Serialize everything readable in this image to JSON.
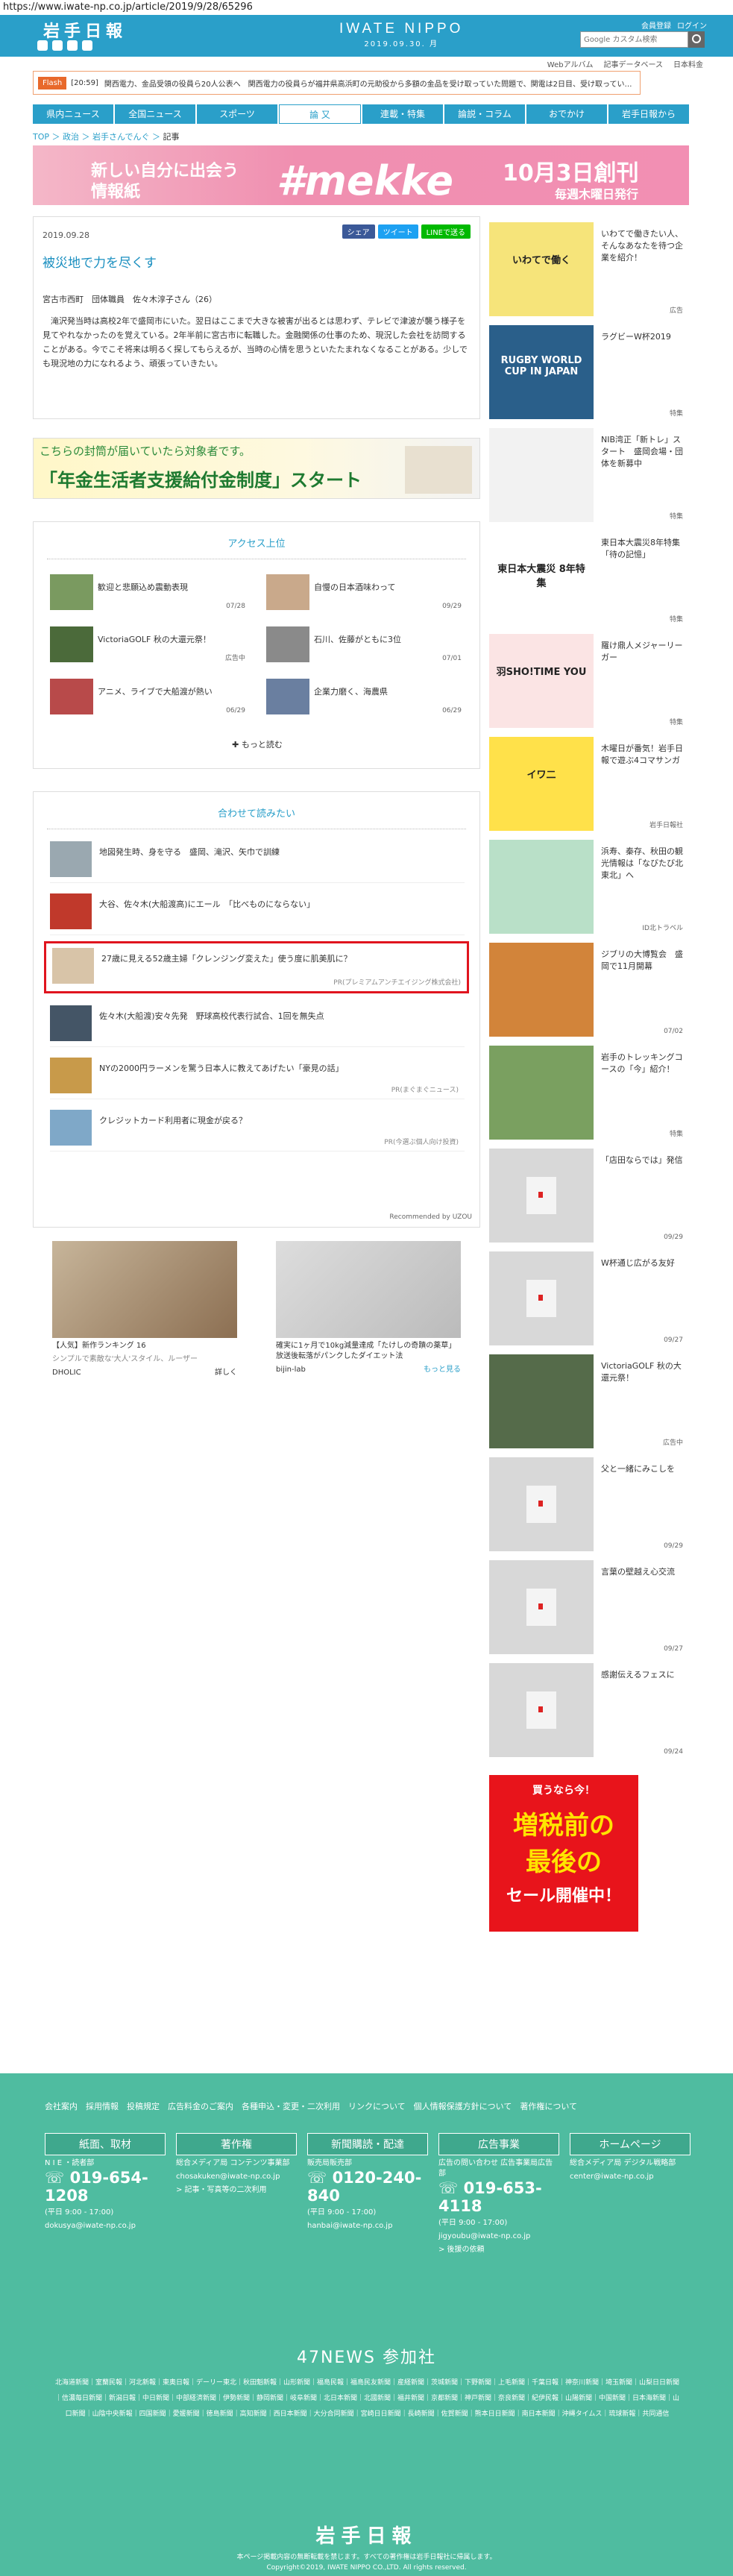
{
  "url": "https://www.iwate-np.co.jp/article/2019/9/28/65296",
  "header": {
    "logo": "岩手日報",
    "brand": "IWATE NIPPO",
    "date": "2019.09.30. 月",
    "register": "会員登録",
    "login": "ログイン",
    "search_placeholder": "Google カスタム検索",
    "sublinks": [
      "Webアルバム",
      "記事データベース",
      "日本料金"
    ]
  },
  "flash": {
    "tag": "Flash",
    "time": "[20:59]",
    "text": "関西電力、金品受領の役員ら20人公表へ　関西電力の役員らが福井県高浜町の元助役から多額の金品を受け取っていた問題で、関電は2日目、受け取ってい…"
  },
  "nav": [
    "県内ニュース",
    "全国ニュース",
    "スポーツ",
    "論 又",
    "連載・特集",
    "論説・コラム",
    "おでかけ",
    "岩手日報から"
  ],
  "breadcrumb": {
    "top": "TOP",
    "cat": "政治",
    "sub": "岩手さんでんぐ",
    "cur": "記事"
  },
  "banner": {
    "l1": "新しい自分に出会う",
    "l2": "情報紙",
    "big": "#mekke",
    "r1": "10月3日創刊",
    "r2": "毎週木曜日発行"
  },
  "article": {
    "date": "2019.09.28",
    "share": [
      "シェア",
      "ツイート",
      "LINEで送る"
    ],
    "title": "被災地で力を尽くす",
    "byline": "宮古市西町　団体職員　佐々木淳子さん（26）",
    "body": "滝沢発当時は高校2年で盛岡市にいた。翌日はここまで大きな被害が出るとは思わず、テレビで津波が襲う様子を見てやれなかったのを覚えている。2年半前に宮古市に転職した。金融関係の仕事のため、現況した会社を訪問することがある。今でこそ将来は明るく探してもらえるが、当時の心情を思うといたたまれなくなることがある。少しでも現況地の力になれるよう、頑張っていきたい。"
  },
  "ad_pension": {
    "small": "こちらの封筒が届いていたら対象者です。",
    "big": "「年金生活者支援給付金制度」スタート"
  },
  "ranking": {
    "title": "アクセス上位",
    "more": "もっと読む",
    "items": [
      {
        "title": "歓迎と悲願込め震動表現",
        "date": "07/28"
      },
      {
        "title": "自慢の日本酒味わって",
        "date": "09/29"
      },
      {
        "title": "VictoriaGOLF 秋の大還元祭！",
        "date": "広告中"
      },
      {
        "title": "石川、佐藤がともに3位",
        "date": "07/01"
      },
      {
        "title": "アニメ、ライブで大船渡が熱い",
        "date": "06/29"
      },
      {
        "title": "企業力磨く、海農県",
        "date": "06/29"
      }
    ]
  },
  "recommend": {
    "title": "合わせて読みたい",
    "footer": "Recommended by UZOU",
    "items": [
      {
        "title": "地図発生時、身を守る　盛岡、滝沢、矢巾で訓練",
        "pr": ""
      },
      {
        "title": "大谷、佐々木(大船渡高)にエール　「比べものにならない」",
        "pr": ""
      },
      {
        "title": "27歳に見える52歳主婦「クレンジング変えた」使う度に肌美肌に？",
        "pr": "PR(プレミアムアンチエイジング株式会社)"
      },
      {
        "title": "佐々木(大船渡)安々先発　野球高校代表行試合、1回を無失点",
        "pr": ""
      },
      {
        "title": "NYの2000円ラーメンを驚う日本人に教えてあげたい「豪見の話」",
        "pr": "PR(まぐまぐニュース)"
      },
      {
        "title": "クレジットカード利用者に現金が戻る？",
        "pr": "PR(今選ぶ個人向け投資)"
      }
    ]
  },
  "ads": {
    "a": {
      "title": "【人気】新作ランキング 16",
      "sub": "シンプルで素敵な'大人'スタイル、ルーザー",
      "brand": "DHOLIC",
      "label": "詳しく"
    },
    "b": {
      "title": "確実に1ヶ月で10kg減量達成「たけしの奇蹟の薬草」放送後転落がパンクしたダイエット法",
      "brand": "bijin-lab",
      "label": "もっと見る",
      "tag": "広告"
    }
  },
  "side": [
    {
      "title": "いわてで働きたい人、そんなあなたを待つ企業を紹介！",
      "tag": "広告",
      "img": "いわてで働く"
    },
    {
      "title": "ラグビーW杯2019",
      "tag": "特集",
      "img": "RUGBY WORLD CUP IN JAPAN"
    },
    {
      "title": "NIB湾正「新トレ」スタート　盛岡会場・団体を新募中",
      "tag": "特集",
      "img": ""
    },
    {
      "title": "東日本大震災8年特集「待の記憶」",
      "tag": "特集",
      "img": "東日本大震災 8年特集"
    },
    {
      "title": "羅け鼎人メジャーリーガー",
      "tag": "特集",
      "img": "羽SHO!TIME YOU"
    },
    {
      "title": "木曜日が番気！岩手日報で遊ぶ4コマサンガ",
      "tag": "岩手日報社",
      "img": "イワ二"
    },
    {
      "title": "浜寿、秦存、秋田の観光情報は「なびたび北東北」へ",
      "tag": "ID北トラベル",
      "img": ""
    },
    {
      "title": "ジブリの大博覧会　盛岡で11月開幕",
      "tag": "07/02",
      "img": ""
    },
    {
      "title": "岩手のトレッキングコースの「今」紹介！",
      "tag": "特集",
      "img": ""
    },
    {
      "title": "「店田ならでは」発信",
      "tag": "09/29",
      "img": ""
    },
    {
      "title": "W杯通じ広がる友好",
      "tag": "09/27",
      "img": ""
    },
    {
      "title": "VictoriaGOLF 秋の大還元祭！",
      "tag": "広告中",
      "img": ""
    },
    {
      "title": "父と一緒にみこしを",
      "tag": "09/29",
      "img": ""
    },
    {
      "title": "言葉の壁越え心交流",
      "tag": "09/27",
      "img": ""
    },
    {
      "title": "感謝伝えるフェスに",
      "tag": "09/24",
      "img": ""
    }
  ],
  "side_ad": {
    "top": "買うなら今！",
    "l1": "増税前の",
    "l2": "最後の",
    "l3": "セール開催中！"
  },
  "footer": {
    "links": "会社案内　採用情報　投稿規定　広告料金のご案内　各種申込・変更・二次利用　リンクについて　個人情報保護方針について　著作権について",
    "cols": [
      {
        "head": "紙面、取材",
        "l1": "N I E ・読者部",
        "phone": "019-654-1208",
        "hours": "(平日 9:00 - 17:00)",
        "mail": "dokusya@iwate-np.co.jp"
      },
      {
        "head": "著作権",
        "l1": "総合メディア局 コンテンツ事業部",
        "phone": "",
        "hours": "",
        "mail": "chosakuken@iwate-np.co.jp",
        "link": "> 記事・写真等の二次利用"
      },
      {
        "head": "新聞購読・配達",
        "l1": "販売局販売部",
        "phone": "0120-240-840",
        "hours": "(平日 9:00 - 17:00)",
        "mail": "hanbai@iwate-np.co.jp"
      },
      {
        "head": "広告事業",
        "l1": "広告の問い合わせ 広告事業局広告部",
        "phone": "019-653-4118",
        "hours": "(平日 9:00 - 17:00)",
        "mail": "jigyoubu@iwate-np.co.jp",
        "link": "> 後援の依頼"
      },
      {
        "head": "ホームページ",
        "l1": "総合メディア局 デジタル戦略部",
        "phone": "",
        "hours": "",
        "mail": "center@iwate-np.co.jp"
      }
    ],
    "news_title": "47NEWS 参加社",
    "news": "北海道新聞｜室蘭民報｜河北新報｜東奥日報｜デーリー東北｜秋田魁新報｜山形新聞｜福島民報｜福島民友新聞｜産経新聞｜茨城新聞｜下野新聞｜上毛新聞｜千葉日報｜神奈川新聞｜埼玉新聞｜山梨日日新聞｜信濃毎日新聞｜新潟日報｜中日新聞｜中部経済新聞｜伊勢新聞｜静岡新聞｜岐阜新聞｜北日本新聞｜北國新聞｜福井新聞｜京都新聞｜神戸新聞｜奈良新聞｜紀伊民報｜山陽新聞｜中国新聞｜日本海新聞｜山口新聞｜山陰中央新報｜四国新聞｜愛媛新聞｜徳島新聞｜高知新聞｜西日本新聞｜大分合同新聞｜宮崎日日新聞｜長崎新聞｜佐賀新聞｜熊本日日新聞｜南日本新聞｜沖縄タイムス｜琉球新報｜共同通信",
    "logo": "岩手日報",
    "notice": "本ページ掲載内容の無断転載を禁じます。すべての著作権は岩手日報社に帰属します。",
    "copy": "Copyright©2019, IWATE NIPPO CO.,LTD. All rights reserved."
  }
}
